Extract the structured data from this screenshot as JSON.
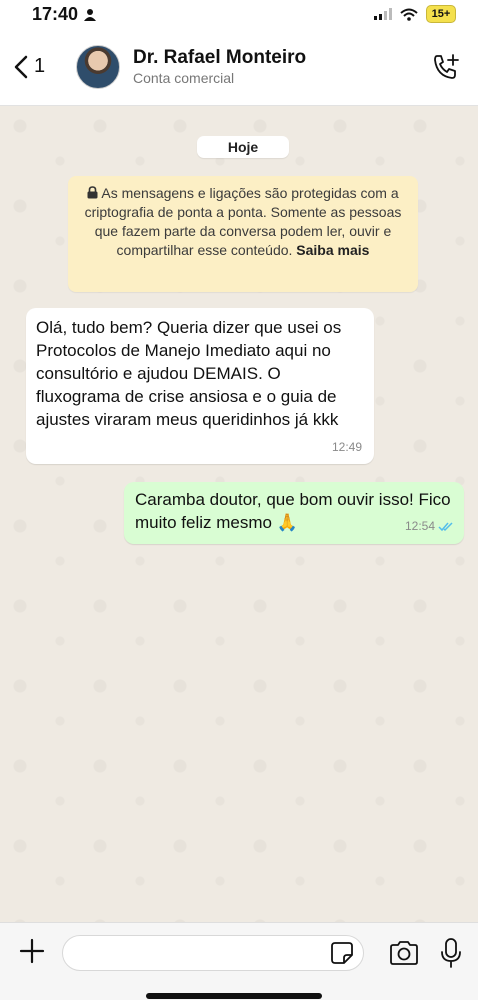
{
  "status_bar": {
    "time": "17:40",
    "battery": "15+"
  },
  "header": {
    "back_count": "1",
    "contact_name": "Dr. Rafael Monteiro",
    "contact_subtitle": "Conta comercial"
  },
  "chat": {
    "date_label": "Hoje",
    "encryption_notice": "As mensagens e ligações são protegidas com a criptografia de ponta a ponta. Somente as pessoas que fazem parte da conversa podem ler, ouvir e compartilhar esse conteúdo.",
    "encryption_link": "Saiba mais",
    "messages": [
      {
        "direction": "incoming",
        "text": "Olá, tudo bem? Queria dizer que usei os Protocolos de Manejo Imediato aqui no consultório e ajudou DEMAIS. O fluxograma de crise ansiosa e o guia de ajustes viraram meus queridinhos já kkk",
        "time": "12:49"
      },
      {
        "direction": "outgoing",
        "text": "Caramba doutor, que bom ouvir isso! Fico muito feliz mesmo 🙏",
        "time": "12:54",
        "status": "read"
      }
    ]
  },
  "composer": {
    "value": "",
    "placeholder": ""
  },
  "colors": {
    "outgoing_bubble": "#d9fdd3",
    "incoming_bubble": "#ffffff",
    "notice_bg": "#fcefc5",
    "read_ticks": "#53bdeb"
  },
  "icons": [
    "person-icon",
    "signal-icon",
    "wifi-icon",
    "back-chevron-icon",
    "add-call-icon",
    "lock-icon",
    "read-ticks-icon",
    "plus-icon",
    "sticker-icon",
    "camera-icon",
    "mic-icon"
  ]
}
